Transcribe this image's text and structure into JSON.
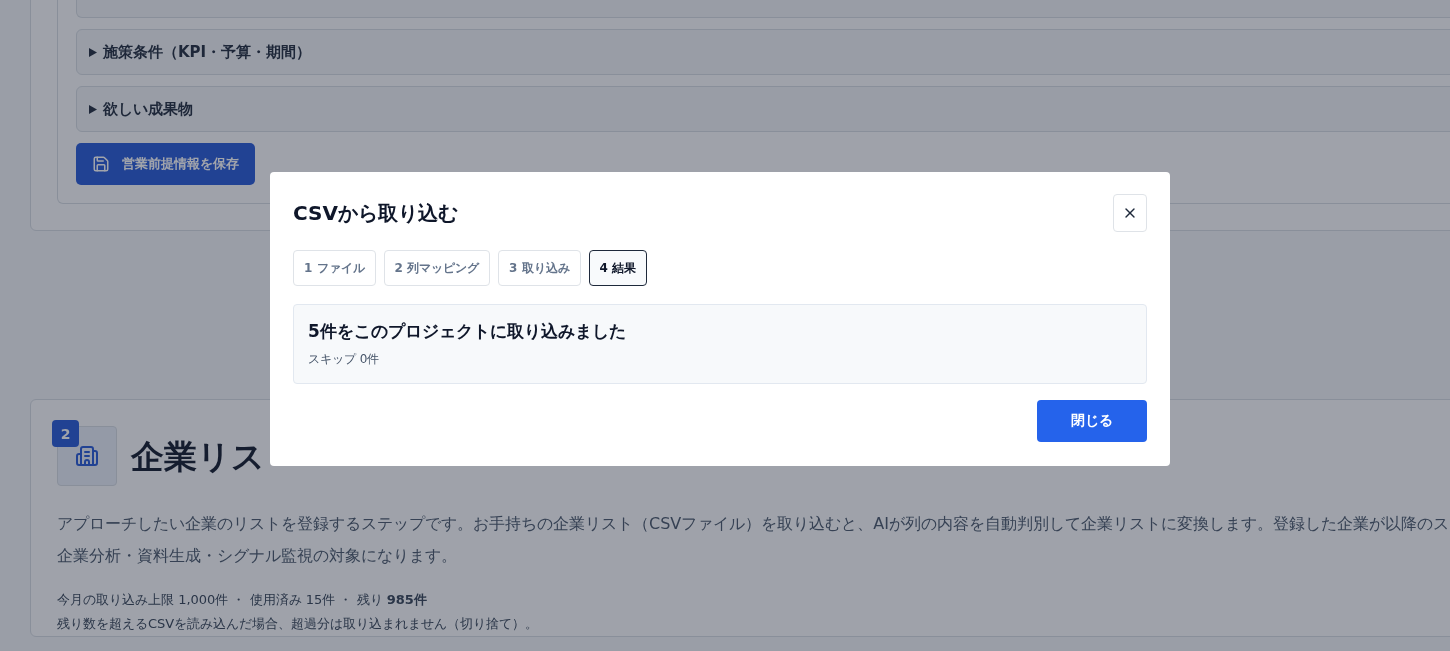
{
  "page": {
    "accordion_items": [
      {
        "label": "施策条件（KPI・予算・期間）",
        "expanded": false
      },
      {
        "label": "欲しい成果物",
        "expanded": false
      }
    ],
    "save_button": "営業前提情報を保存",
    "section": {
      "step": "2",
      "title": "企業リス",
      "description_lines": [
        "アプローチしたい企業のリストを登録するステップです。お手持ちの企業リスト（CSVファイル）を取り込むと、AIが列の内容を自動判別して企業リストに変換します。登録した企業が以降のス",
        "企業分析・資料生成・シグナル監視の対象になります。"
      ],
      "quota": "今月の取り込み上限 1,000件 ・ 使用済み 15件 ・ 残り **985件**",
      "note": "残り数を超えるCSVを読み込んだ場合、超過分は取り込まれません（切り捨て）。"
    }
  },
  "dialog": {
    "title": "CSVから取り込む",
    "steps": [
      {
        "label": "1 ファイル",
        "selected": false
      },
      {
        "label": "2 列マッピング",
        "selected": false
      },
      {
        "label": "3 取り込み",
        "selected": false
      },
      {
        "label": "4 結果",
        "selected": true
      }
    ],
    "result": {
      "heading": "5件をこのプロジェクトに取り込みました",
      "detail": "スキップ 0件"
    },
    "close_button": "閉じる"
  }
}
